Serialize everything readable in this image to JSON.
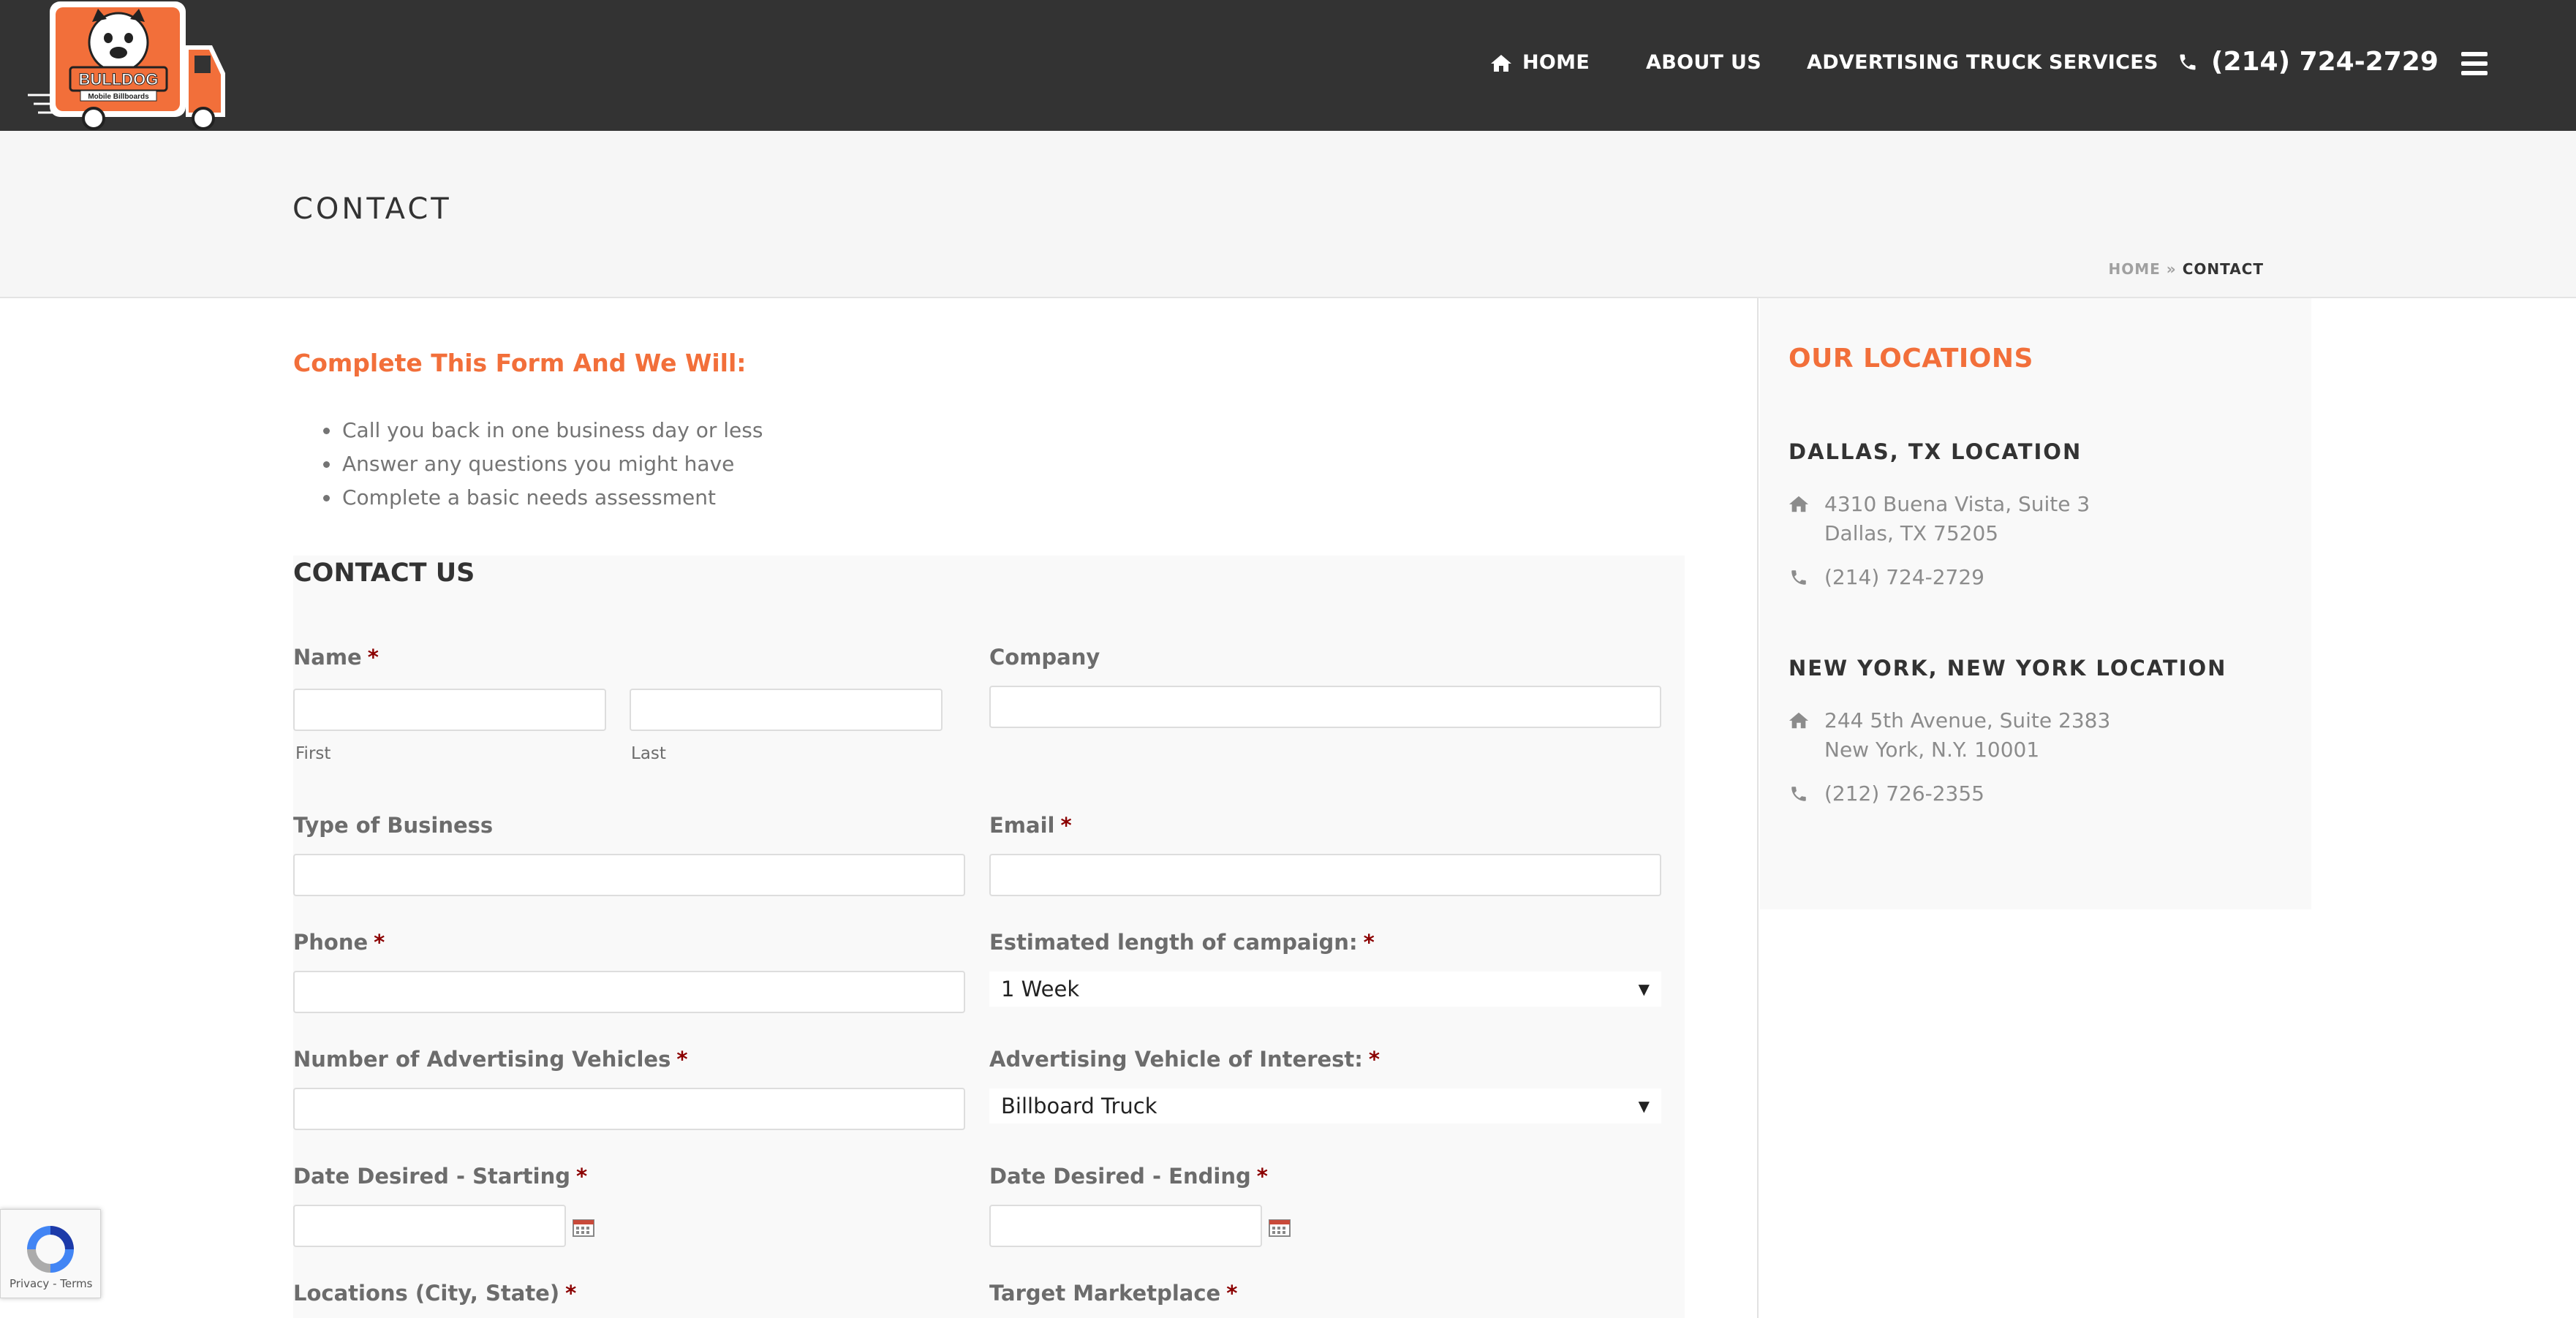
{
  "header": {
    "logo_text": "BULLDOG",
    "logo_subtext": "Mobile Billboards",
    "nav": {
      "home": "HOME",
      "about": "ABOUT US",
      "services": "ADVERTISING TRUCK SERVICES",
      "phone": "(214) 724-2729"
    }
  },
  "titlebar": {
    "title": "CONTACT",
    "breadcrumb_home": "HOME",
    "breadcrumb_sep": "»",
    "breadcrumb_current": "CONTACT"
  },
  "intro": {
    "heading": "Complete This Form And We Will:",
    "items": [
      "Call you back in one business day or less",
      "Answer any questions you might have",
      "Complete a basic needs assessment"
    ]
  },
  "form": {
    "title": "CONTACT US",
    "required_mark": "*",
    "name_label": "Name",
    "first_sublabel": "First",
    "last_sublabel": "Last",
    "company_label": "Company",
    "business_type_label": "Type of Business",
    "email_label": "Email",
    "phone_label": "Phone",
    "campaign_length_label": "Estimated length of campaign:",
    "campaign_length_value": "1 Week",
    "vehicle_count_label": "Number of Advertising Vehicles",
    "vehicle_interest_label": "Advertising Vehicle of Interest:",
    "vehicle_interest_value": "Billboard Truck",
    "date_start_label": "Date Desired - Starting",
    "date_end_label": "Date Desired - Ending",
    "locations_label": "Locations (City, State)",
    "target_label": "Target Marketplace"
  },
  "sidebar": {
    "title": "OUR LOCATIONS",
    "locations": [
      {
        "title": "DALLAS, TX LOCATION",
        "address_line1": "4310 Buena Vista, Suite 3",
        "address_line2": "Dallas, TX 75205",
        "phone": "(214) 724-2729"
      },
      {
        "title": "NEW YORK, NEW YORK LOCATION",
        "address_line1": "244 5th Avenue, Suite 2383",
        "address_line2": "New York, N.Y. 10001",
        "phone": "(212) 726-2355"
      }
    ]
  },
  "recaptcha": {
    "links": "Privacy - Terms"
  },
  "colors": {
    "header_bg": "#333333",
    "accent": "#f26f3a",
    "required": "#8b0000",
    "titlebar_bg": "#f6f6f6"
  },
  "icons": {
    "home": "home-icon",
    "phone": "phone-icon",
    "menu": "hamburger-menu-icon",
    "calendar": "calendar-icon",
    "location_home": "home-icon",
    "location_phone": "phone-icon"
  }
}
